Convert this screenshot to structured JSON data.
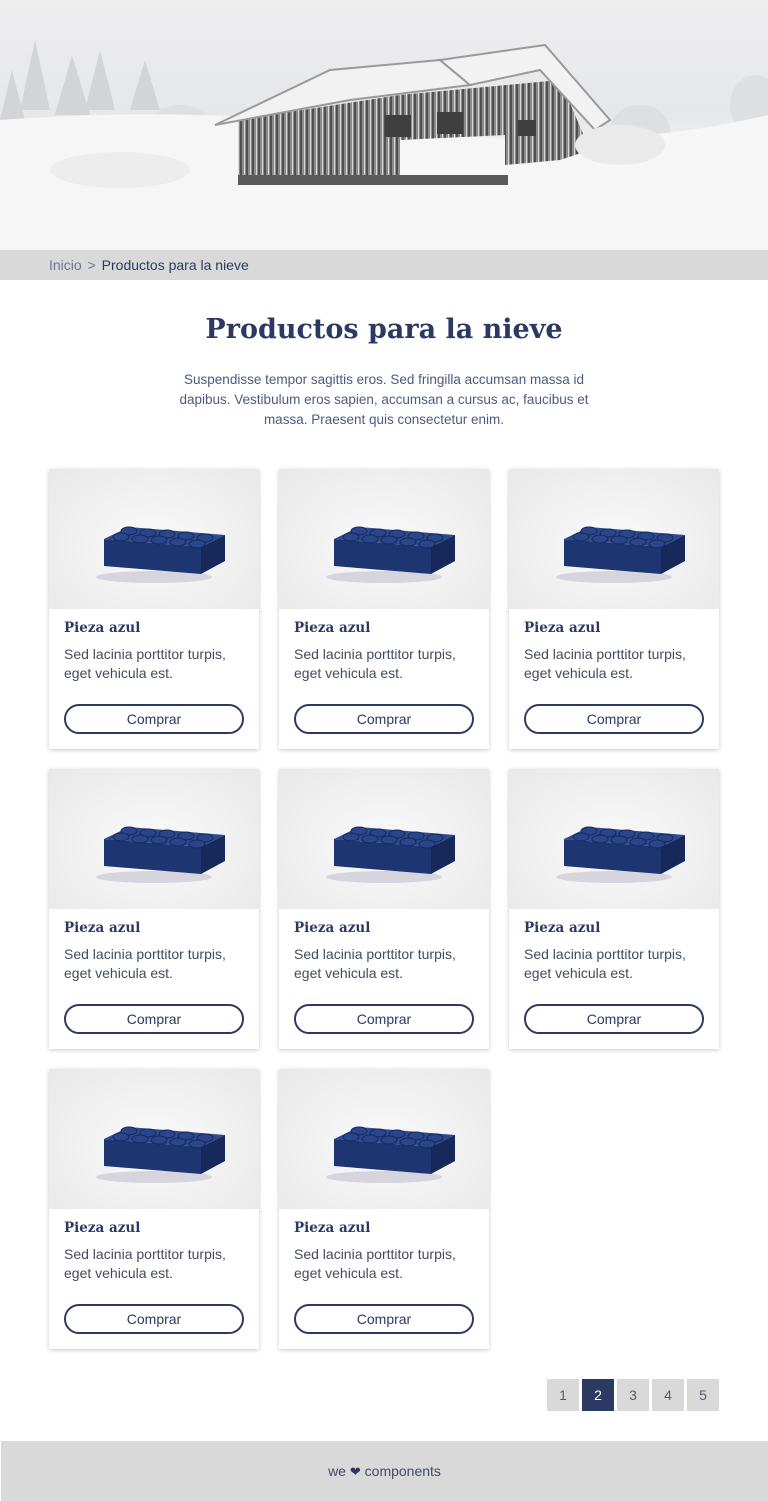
{
  "hero": {
    "image": "snow-covered-cabin"
  },
  "breadcrumb": {
    "home": "Inicio",
    "separator": ">",
    "current": "Productos para la nieve"
  },
  "title": "Productos para la nieve",
  "intro": "Suspendisse tempor sagittis eros. Sed fringilla accumsan massa id dapibus. Vestibulum eros sapien, accumsan a cursus ac, faucibus et massa. Praesent quis consectetur enim.",
  "products": [
    {
      "name": "Pieza azul",
      "description": "Sed lacinia porttitor turpis, eget vehicula est.",
      "button": "Comprar",
      "image": "blue-lego-brick"
    },
    {
      "name": "Pieza azul",
      "description": "Sed lacinia porttitor turpis, eget vehicula est.",
      "button": "Comprar",
      "image": "blue-lego-brick"
    },
    {
      "name": "Pieza azul",
      "description": "Sed lacinia porttitor turpis, eget vehicula est.",
      "button": "Comprar",
      "image": "blue-lego-brick"
    },
    {
      "name": "Pieza azul",
      "description": "Sed lacinia porttitor turpis, eget vehicula est.",
      "button": "Comprar",
      "image": "blue-lego-brick"
    },
    {
      "name": "Pieza azul",
      "description": "Sed lacinia porttitor turpis, eget vehicula est.",
      "button": "Comprar",
      "image": "blue-lego-brick"
    },
    {
      "name": "Pieza azul",
      "description": "Sed lacinia porttitor turpis, eget vehicula est.",
      "button": "Comprar",
      "image": "blue-lego-brick"
    },
    {
      "name": "Pieza azul",
      "description": "Sed lacinia porttitor turpis, eget vehicula est.",
      "button": "Comprar",
      "image": "blue-lego-brick"
    },
    {
      "name": "Pieza azul",
      "description": "Sed lacinia porttitor turpis, eget vehicula est.",
      "button": "Comprar",
      "image": "blue-lego-brick"
    }
  ],
  "pagination": {
    "pages": [
      "1",
      "2",
      "3",
      "4",
      "5"
    ],
    "current": "2"
  },
  "footer": {
    "before": "we",
    "icon": "heart-icon",
    "after": "components"
  },
  "colors": {
    "primary": "#2c3a63",
    "bar_gray": "#d9d9d9",
    "brick_blue": "#1f3a7a"
  }
}
